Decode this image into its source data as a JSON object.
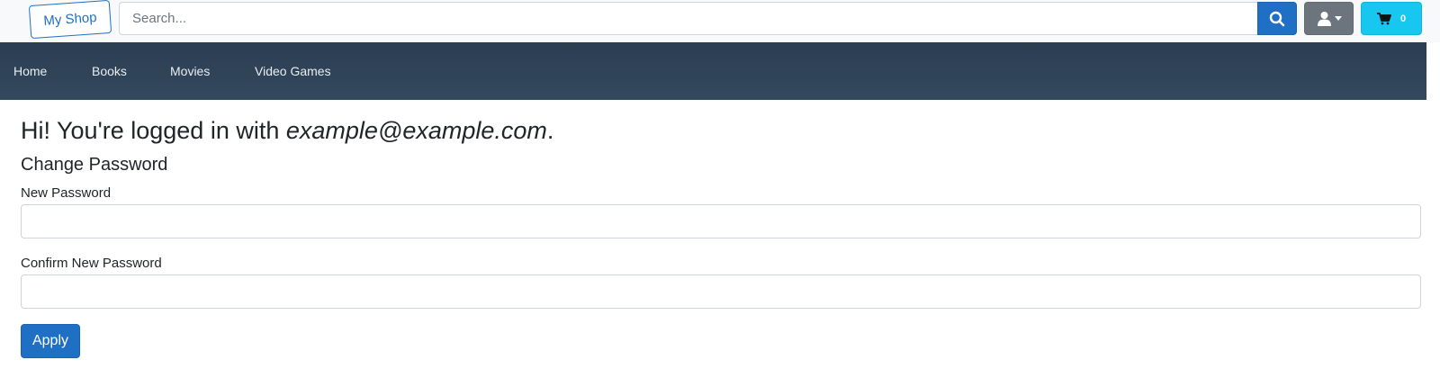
{
  "header": {
    "brand": "My Shop",
    "search": {
      "placeholder": "Search...",
      "value": ""
    },
    "search_icon": "search-icon",
    "user_icon": "user-icon",
    "user_caret_icon": "caret-down-icon",
    "cart_icon": "cart-icon",
    "cart_count": "0"
  },
  "nav": {
    "items": [
      {
        "label": "Home"
      },
      {
        "label": "Books"
      },
      {
        "label": "Movies"
      },
      {
        "label": "Video Games"
      }
    ]
  },
  "main": {
    "greeting_prefix": "Hi! You're logged in with ",
    "email": "example@example.com",
    "greeting_suffix": ".",
    "section_title": "Change Password",
    "new_password_label": "New Password",
    "new_password_value": "",
    "confirm_password_label": "Confirm New Password",
    "confirm_password_value": "",
    "apply_label": "Apply"
  },
  "colors": {
    "primary": "#1f6fc5",
    "secondary": "#6c757d",
    "info": "#17c7ef",
    "navbar": "#2f4358"
  }
}
